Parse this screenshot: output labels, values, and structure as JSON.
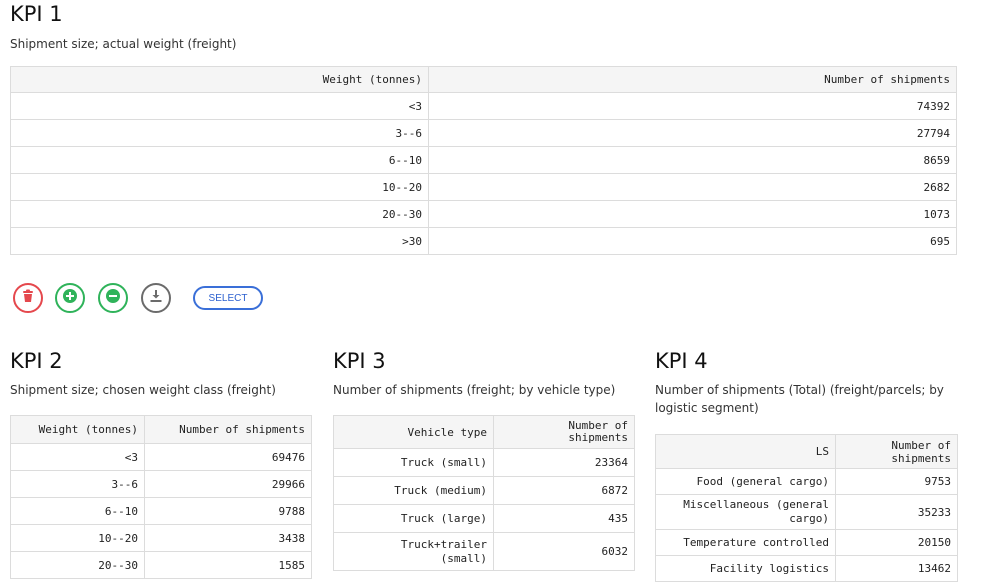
{
  "kpi1": {
    "title": "KPI 1",
    "subtitle": "Shipment size; actual weight (freight)",
    "columns": [
      "Weight (tonnes)",
      "Number of shipments"
    ],
    "rows": [
      [
        "<3",
        "74392"
      ],
      [
        "3--6",
        "27794"
      ],
      [
        "6--10",
        "8659"
      ],
      [
        "10--20",
        "2682"
      ],
      [
        "20--30",
        "1073"
      ],
      [
        ">30",
        "695"
      ]
    ]
  },
  "toolbar": {
    "delete_icon": "trash-icon",
    "add_icon": "plus-circle-icon",
    "remove_icon": "minus-circle-icon",
    "download_icon": "download-icon",
    "select_label": "SELECT",
    "colors": {
      "delete": "#e5484d",
      "add": "#2fb35a",
      "remove": "#2fb35a",
      "download": "#6b6b6b",
      "select": "#3a6fd8"
    }
  },
  "kpi2": {
    "title": "KPI 2",
    "subtitle": "Shipment size; chosen weight class (freight)",
    "columns": [
      "Weight (tonnes)",
      "Number of shipments"
    ],
    "rows": [
      [
        "<3",
        "69476"
      ],
      [
        "3--6",
        "29966"
      ],
      [
        "6--10",
        "9788"
      ],
      [
        "10--20",
        "3438"
      ],
      [
        "20--30",
        "1585"
      ]
    ]
  },
  "kpi3": {
    "title": "KPI 3",
    "subtitle": "Number of shipments (freight; by vehicle type)",
    "columns": [
      "Vehicle type",
      "Number of\nshipments"
    ],
    "rows": [
      [
        "Truck (small)",
        "23364"
      ],
      [
        "Truck (medium)",
        "6872"
      ],
      [
        "Truck (large)",
        "435"
      ],
      [
        "Truck+trailer\n(small)",
        "6032"
      ]
    ]
  },
  "kpi4": {
    "title": "KPI 4",
    "subtitle": "Number of shipments (Total) (freight/parcels; by logistic segment)",
    "columns": [
      "LS",
      "Number of\nshipments"
    ],
    "rows": [
      [
        "Food (general cargo)",
        "9753"
      ],
      [
        "Miscellaneous (general\ncargo)",
        "35233"
      ],
      [
        "Temperature controlled",
        "20150"
      ],
      [
        "Facility logistics",
        "13462"
      ]
    ]
  }
}
